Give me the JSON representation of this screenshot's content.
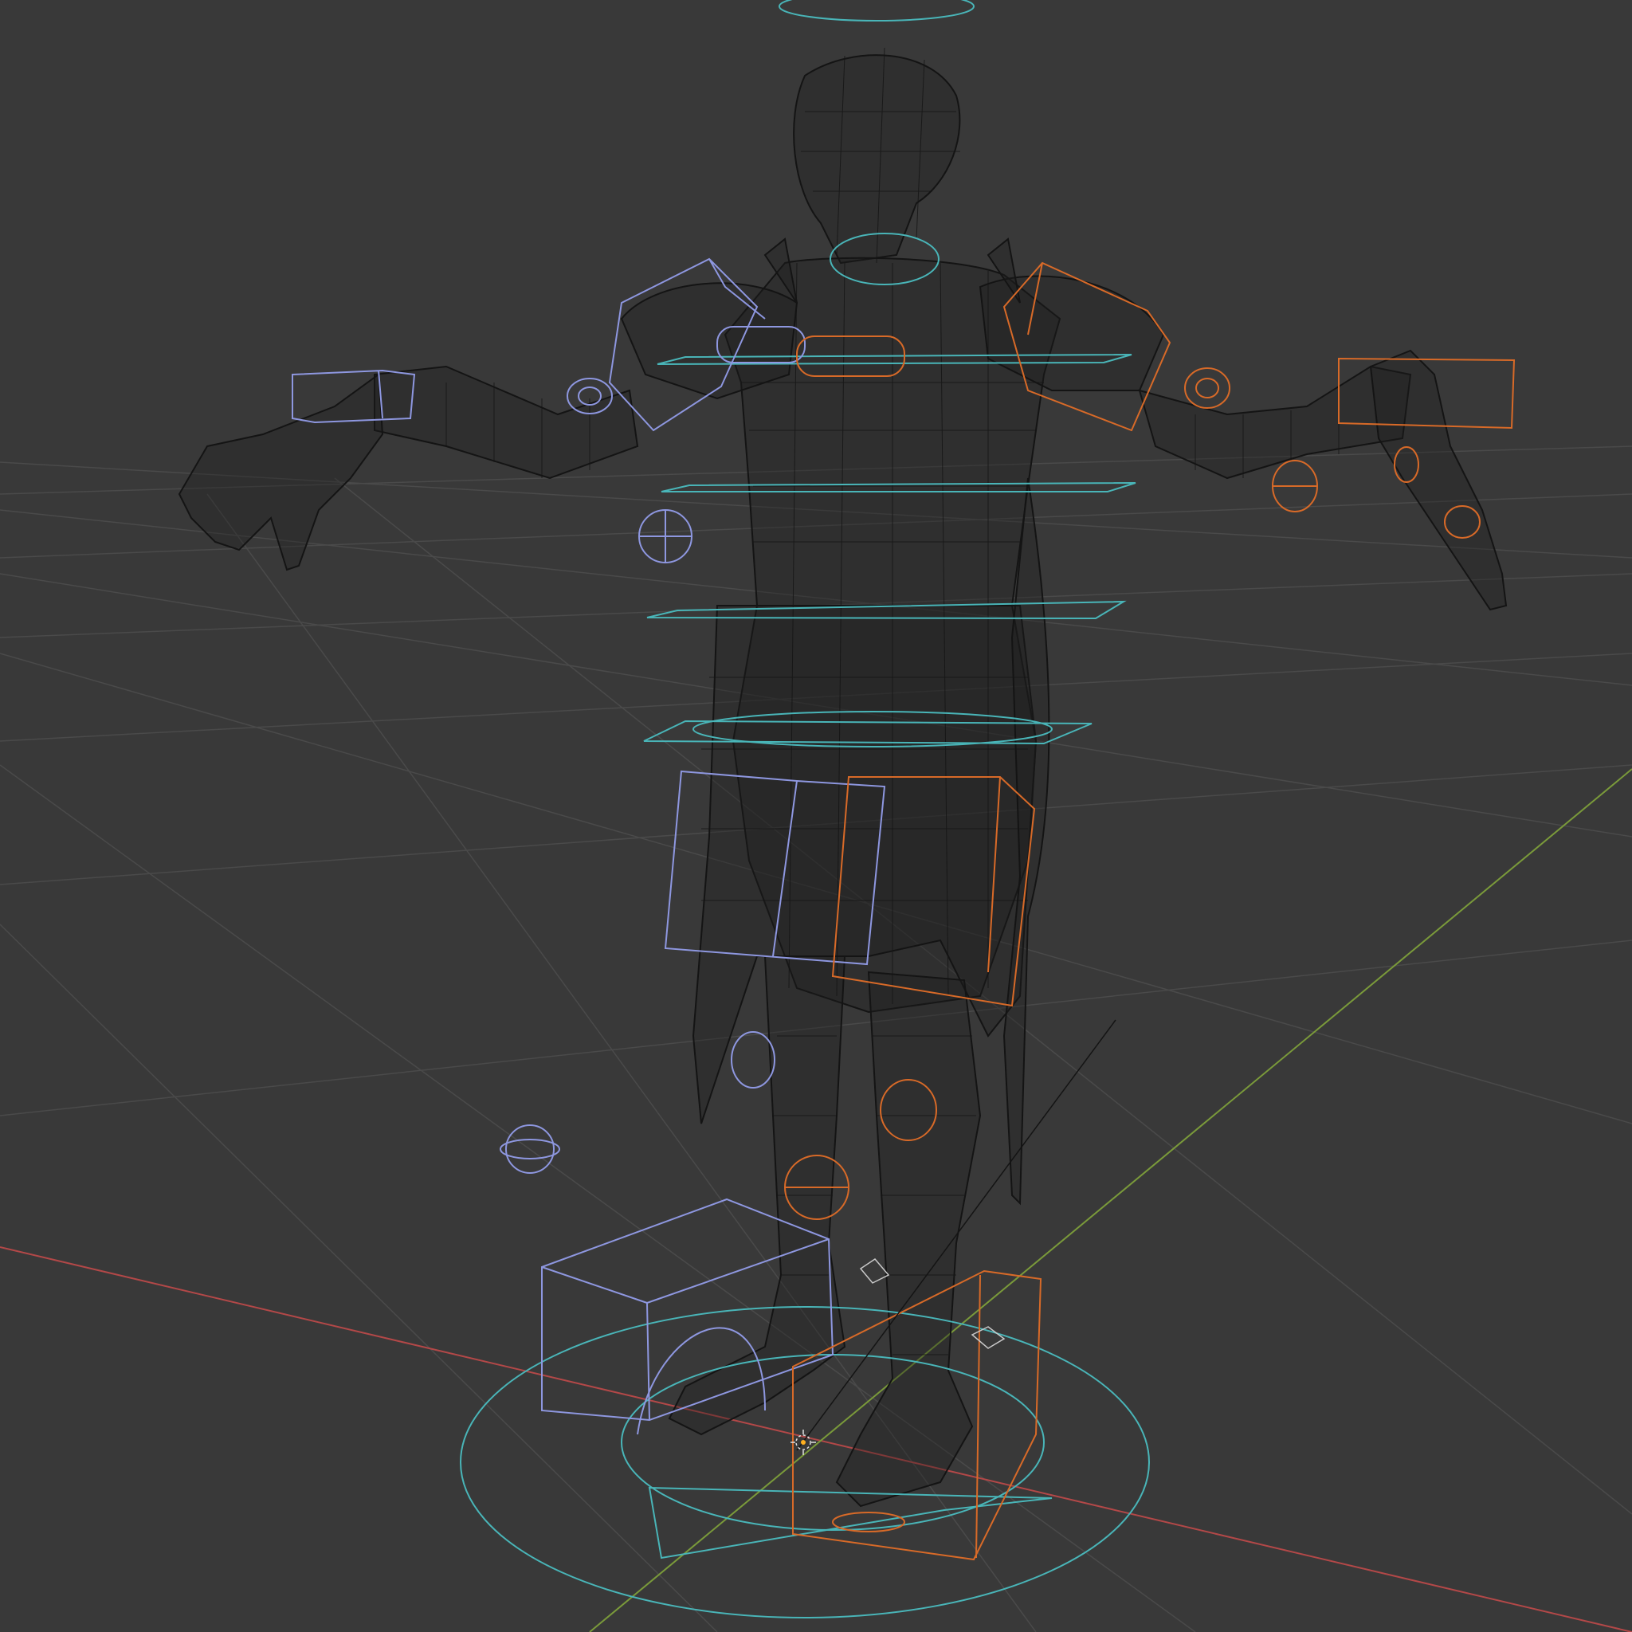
{
  "viewport": {
    "mode": "wireframe",
    "shading": "wireframe",
    "background_color": "#393939",
    "grid_color": "#4a4a4a",
    "x_axis_color": "#b34848",
    "y_axis_color": "#7a9a3a",
    "mesh_color": "#141414"
  },
  "rig": {
    "left_controls_color": "#8e97e0",
    "right_controls_color": "#d86a28",
    "center_controls_color": "#49b5b8"
  },
  "icons": {
    "origin": "3d-cursor-icon"
  }
}
